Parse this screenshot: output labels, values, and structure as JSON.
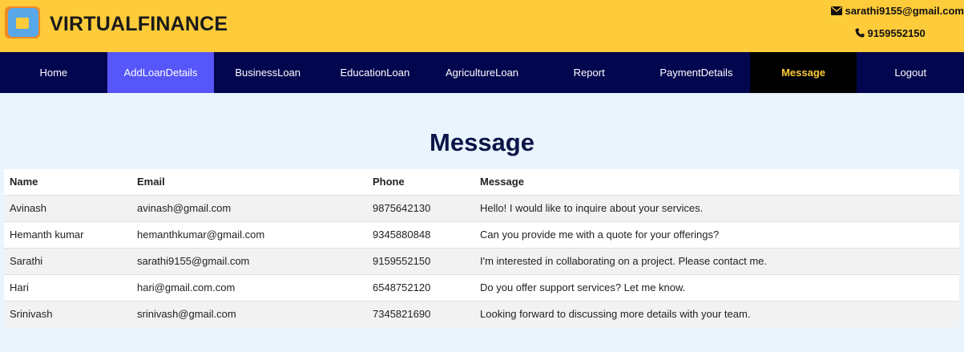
{
  "header": {
    "brand": "VIRTUALFINANCE",
    "email": "sarathi9155@gmail.com",
    "phone": "9159552150",
    "accent": "#fecb3a"
  },
  "nav": {
    "items": [
      {
        "label": "Home"
      },
      {
        "label": "AddLoanDetails"
      },
      {
        "label": "BusinessLoan"
      },
      {
        "label": "EducationLoan"
      },
      {
        "label": "AgricultureLoan"
      },
      {
        "label": "Report"
      },
      {
        "label": "PaymentDetails"
      },
      {
        "label": "Message"
      },
      {
        "label": "Logout"
      }
    ]
  },
  "page": {
    "title": "Message"
  },
  "table": {
    "headers": [
      "Name",
      "Email",
      "Phone",
      "Message"
    ],
    "rows": [
      [
        "Avinash",
        "avinash@gmail.com",
        "9875642130",
        "Hello! I would like to inquire about your services."
      ],
      [
        "Hemanth kumar",
        "hemanthkumar@gmail.com",
        "9345880848",
        "Can you provide me with a quote for your offerings?"
      ],
      [
        "Sarathi",
        "sarathi9155@gmail.com",
        "9159552150",
        "I'm interested in collaborating on a project. Please contact me."
      ],
      [
        "Hari",
        "hari@gmail.com.com",
        "6548752120",
        "Do you offer support services? Let me know."
      ],
      [
        "Srinivash",
        "srinivash@gmail.com",
        "7345821690",
        "Looking forward to discussing more details with your team."
      ]
    ]
  }
}
